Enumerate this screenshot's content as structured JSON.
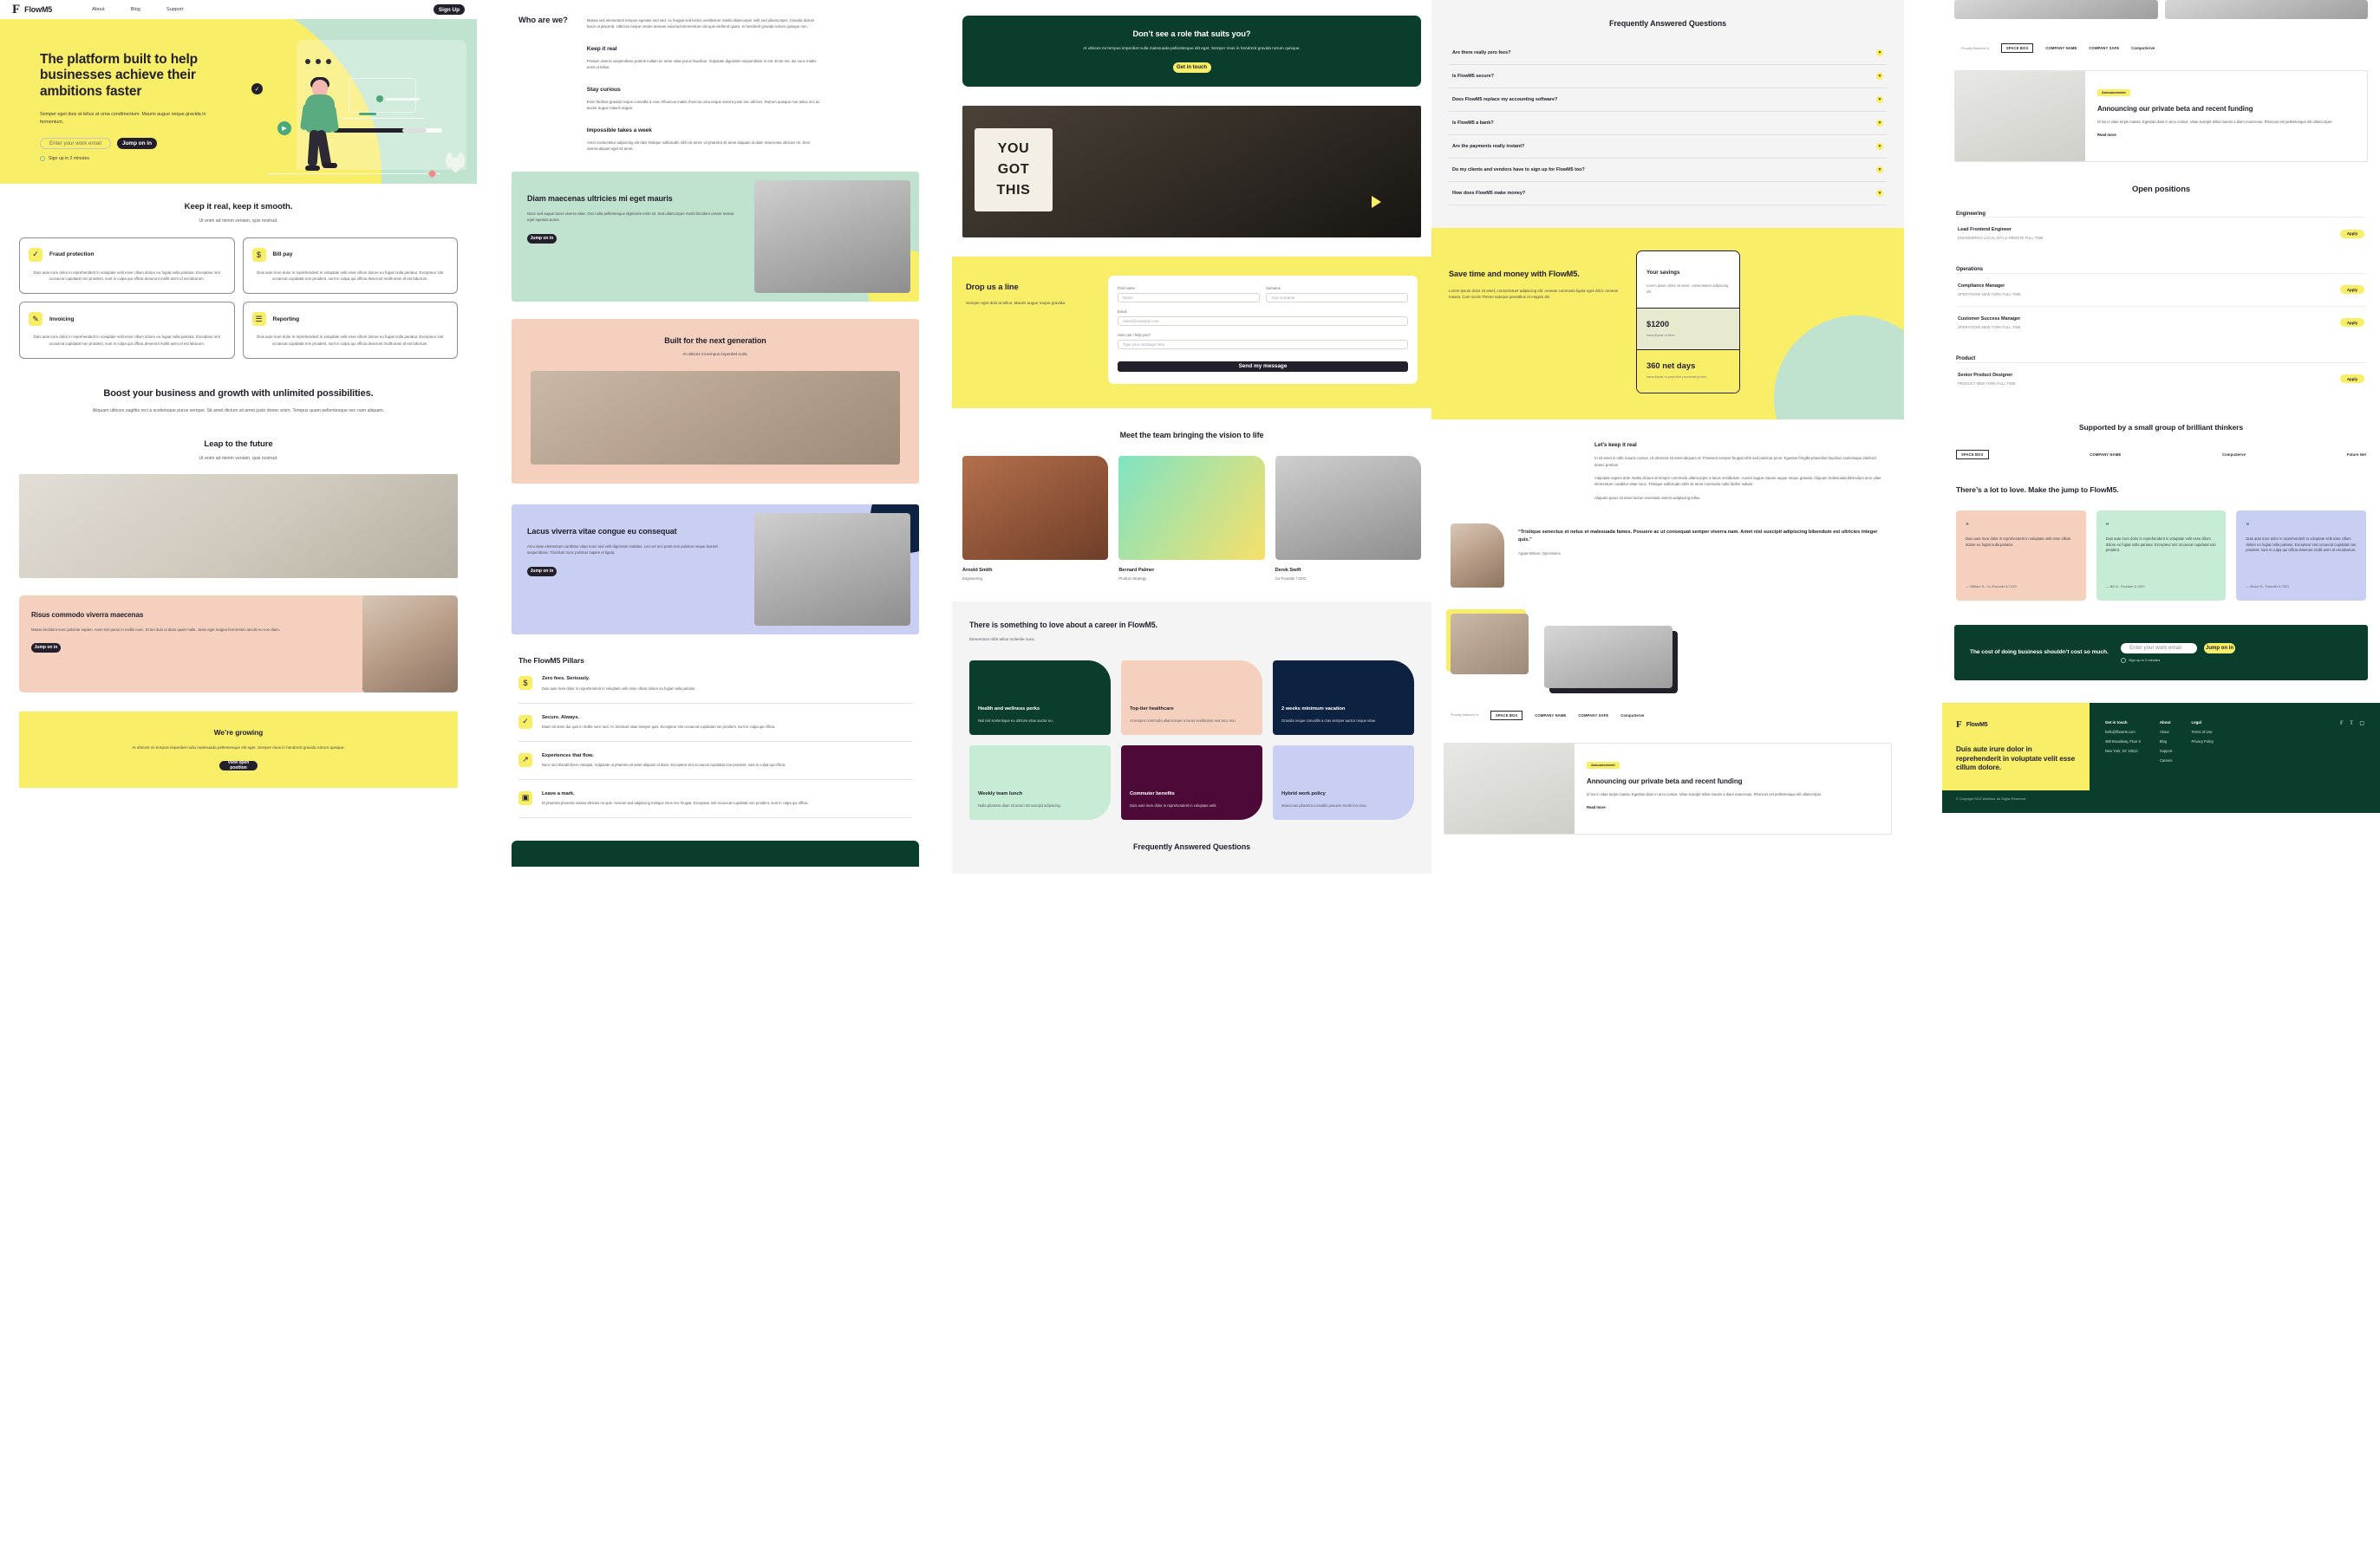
{
  "brand": {
    "name": "FlowM5",
    "mark": "F",
    "accent": "#f9ee68",
    "dark": "#0b3d2c",
    "ink": "#23202b"
  },
  "nav": {
    "links": [
      "About",
      "Blog",
      "Support"
    ],
    "cta": "Sign Up"
  },
  "hero": {
    "title": "The platform built to help businesses achieve their ambitions faster",
    "sub": "Semper eget duis at tellus at urna condimentum. Mauris augue neque gravida in fermentum.",
    "email_placeholder": "Enter your work email",
    "cta": "Jump on in",
    "note": "Sign up in 2 minutes"
  },
  "features": {
    "title": "Keep it real, keep it smooth.",
    "lead": "Ut enim ad minim veniam, quis nostrud.",
    "body": "Duis aute irure dolor in reprehenderit in voluptate velit esse cillum dolore eu fugiat nulla pariatur. Excepteur sint occaecat cupidatat non proident, sunt in culpa qui officia deserunt mollit anim id est laborum.",
    "items": [
      {
        "title": "Fraud protection",
        "icon": "shield-icon",
        "glyph": "✓"
      },
      {
        "title": "Bill pay",
        "icon": "dollar-icon",
        "glyph": "$"
      },
      {
        "title": "Invoicing",
        "icon": "document-edit-icon",
        "glyph": "✎"
      },
      {
        "title": "Reporting",
        "icon": "chart-icon",
        "glyph": "☰"
      }
    ]
  },
  "boost": {
    "title": "Boost your business and growth with unlimited possibilities.",
    "body": "Aliquam ultrices sagittis orci a scelerisque purus semper. Sit amet dictum sit amet justo donec enim. Tempus quam pellentesque nec nam aliquam."
  },
  "leap": {
    "title": "Leap to the future",
    "lead": "Ut enim ad minim veniam, quis nostrud."
  },
  "risus": {
    "title": "Risus commodo viverra maecenas",
    "body": "Massa tincidunt nunc pulvinar sapien. Amet nisl purus in mollis nunc. Et leo duis ut diam quam nulla. Justo eget magna fermentum iaculis eu non diam.",
    "cta": "Jump on in"
  },
  "growing": {
    "title": "We’re growing",
    "body": "At ultrices mi tempus imperdiet nulla malesuada pellentesque elit eget. Semper risus in hendrerit gravida rutrum quisque.",
    "cta": "View open position"
  },
  "whoare": {
    "title": "Who are we?",
    "intro": "Massa sed elementum tempus egestas sed sed. Ac feugiat sed lectus vestibulum mattis ullamcorper velit sed ullamcorper. Gravida dictum fusce ut placerat. Ultricies neque ornare aenean euismod elementum nisi quis eleifend quam. In hendrerit gravida rutrum quisque non.",
    "blocks": [
      {
        "title": "Keep it real",
        "body": "Pretium viverra suspendisse potenti nullam ac tortor vitae purus faucibus. Vulputate dignissim suspendisse in est. Enim nec dui nunc mattis enim ut tellus."
      },
      {
        "title": "Stay curious",
        "body": "Enim facilisis gravida neque convallis a cras. Rhoncus mattis rhoncus urna neque viverra justo nec ultrices. Rutrum quisque non tellus orci ac auctor augue mauris augue."
      },
      {
        "title": "Impossible takes a week",
        "body": "Amet consectetur adipiscing elit duis tristique sollicitudin nibh sit amet. Ut pharetra sit amet aliquam id diam maecenas ultricies mi. Sem viverra aliquet eget sit amet."
      }
    ]
  },
  "promo_mint": {
    "title": "Diam maecenas ultricies mi eget mauris",
    "body": "Nunc sed augue lacus viverra vitae. Orci nulla pellentesque dignissim enim sit. Sed ullamcorper morbi tincidunt ornare massa eget egestas purus.",
    "cta": "Jump on in"
  },
  "generation": {
    "title": "Built for the next generation",
    "lead": "At ultrices mi tempus imperdiet nulla."
  },
  "promo_lilac": {
    "title": "Lacus viverra vitae congue eu consequat",
    "body": "Arcu vitae elementum curabitur vitae nunc sed velit dignissim sodales. Leo vel orci porta non pulvinar neque laoreet suspendisse. Tincidunt nunc pulvinar sapien et ligula.",
    "cta": "Jump on in"
  },
  "pillars": {
    "title": "The FlowM5 Pillars",
    "items": [
      {
        "title": "Zero fees. Seriously.",
        "icon": "dollar-icon",
        "glyph": "$",
        "body": "Duis aute irure dolor in reprehenderit in voluptate velit esse cillum dolore eu fugiat nulla pariatur."
      },
      {
        "title": "Secure. Always.",
        "icon": "shield-icon",
        "glyph": "✓",
        "body": "Etiam sit amet dui quis in mollis nunc sed. Ac tincidunt vitae semper quis. Excepteur sint occaecat cupidatat non proident, sunt in culpa qui officia."
      },
      {
        "title": "Experiences that flow.",
        "icon": "trend-up-icon",
        "glyph": "↗",
        "body": "Nunc sed blandit libero volutpat. Vulputate ut pharetra sit amet aliquam id diam. Excepteur sint occaecat cupidatat non proident, sunt in culpa qui officia."
      },
      {
        "title": "Leave a mark.",
        "icon": "image-icon",
        "glyph": "▣",
        "body": "Et pharetra pharetra massa ultricies mi quis. Aenean sed adipiscing tristique risus nec feugiat. Excepteur sint occaecat cupidatat non proident, sunt in culpa qui officia."
      }
    ]
  },
  "role_cta": {
    "title": "Don’t see a role that suits you?",
    "body": "At ultrices mi tempus imperdiet nulla malesuada pellentesque elit eget. Semper risus in hendrerit gravida rutrum quisque.",
    "cta": "Get in touch"
  },
  "sign_photo": {
    "line1": "YOU",
    "line2": "GOT",
    "line3": "THIS"
  },
  "contact": {
    "title": "Drop us a line",
    "body": "Semper eget duis at tellus. Mauris augue neque gravida.",
    "fields": [
      {
        "label": "First name",
        "placeholder": "Name"
      },
      {
        "label": "Surname",
        "placeholder": "Your surname"
      },
      {
        "label": "Email",
        "placeholder": "name@example.com"
      },
      {
        "label": "How can I help you?",
        "placeholder": ""
      },
      {
        "label": "Type your message here",
        "placeholder": "Type your message here"
      }
    ],
    "cta": "Send my message"
  },
  "team": {
    "title": "Meet the team bringing the vision to life",
    "members": [
      {
        "name": "Arnold Smith",
        "role": "Engineering",
        "avatar": "ph-p1"
      },
      {
        "name": "Bernard Palmer",
        "role": "Product Strategy",
        "avatar": "ph-p2"
      },
      {
        "name": "Derek Swift",
        "role": "Co-Founder / CEO",
        "avatar": "ph-p3"
      }
    ]
  },
  "careers": {
    "title": "There is something to love about a career in FlowM5.",
    "lead": "Elementum nibh tellus molestie nunc.",
    "faq_title": "Frequently Answered Questions",
    "perks": [
      {
        "title": "Health and wellness perks",
        "body": "Nisl nisl scelerisque eu ultrices vitae auctor eu.",
        "bg": "dgreen",
        "dark": true,
        "round": "r1"
      },
      {
        "title": "Top-tier healthcare",
        "body": "At tempor commodo ullamcorper a lacus vestibulum sed arcu non.",
        "bg": "peach",
        "dark": false,
        "round": "r1"
      },
      {
        "title": "2 weeks minimum vacation",
        "body": "Gravida neque convallis a cras semper auctor neque vitae.",
        "bg": "navy",
        "dark": true,
        "round": "r1"
      },
      {
        "title": "Weekly team lunch",
        "body": "Nulla pharetra diam sit amet nisl suscipit adipiscing.",
        "bg": "ltmint",
        "dark": false,
        "round": "r2"
      },
      {
        "title": "Commuter benefits",
        "body": "Duis aute irure dolor in reprehenderit in voluptate velit.",
        "bg": "plum",
        "dark": true,
        "round": "r2"
      },
      {
        "title": "Hybrid work policy",
        "body": "Maecenas pharetra convallis posuere morbi leo urna.",
        "bg": "lilac",
        "dark": false,
        "round": "r2"
      }
    ]
  },
  "faq": {
    "title": "Frequently Answered Questions",
    "items": [
      "Are there really zero fees?",
      "Is FlowM5 secure?",
      "Does FlowM5 replace my accounting software?",
      "Is FlowM5 a bank?",
      "Are the payments really instant?",
      "Do my clients and vendors have to sign up for FlowM5 too?",
      "How does FlowM5 make money?"
    ]
  },
  "savings": {
    "title": "Save time and money with FlowM5.",
    "body": "Lorem ipsum dolor sit amet, consectetuer adipiscing elit. Aenean commodo ligula eget dolor. Aenean massa. Cum sociis Theme natoque penatibus et magnis dis",
    "card_title": "Your savings",
    "card_sub": "Lorem ipsum dolor sit amet, consectetuer adipiscing elit.",
    "metric1_value": "$1200",
    "metric1_caption": "saved/year in fees",
    "metric2_value": "360 net days",
    "metric2_caption": "saved/year in payment processing time"
  },
  "keepreal": {
    "title": "Let’s keep it real",
    "p1": "In sit amet in nibh mauris cursus. Ut pharetra sit amet aliquam id. Praesent semper feugiat nibh sed pulvinar proin. Egestas fringilla phasellus faucibus scelerisque eleifend donec pretium.",
    "p2": "Vulputate sapien ante mattis dictum at tempor commodo ullamcorper a lacus vestibulum. Auctor augue mauris augue neque gravida. Aliquam malesuada bibendum arcu vitae elementum curabitur vitae nunc. Tristique sollicitudin nibh sit amet commodo nulla facilisi nullam.",
    "p3": "Aliquam purus sit amet luctus venenatis viverra adipiscing tellus."
  },
  "quote": {
    "text": "“Tristique senectus et netus et malesuada fames. Posuere ac ut consequat semper viverra nam. Amet nisl suscipit adipiscing bibendum est ultricies integer quis.”",
    "author": "Agata Wilson, Operations"
  },
  "logos": {
    "label": "Proudly featured in",
    "items": [
      "SPACE BOX",
      "COMPANY NAME",
      "COMPANY SAFE",
      "CompuServe"
    ]
  },
  "announcement": {
    "tag": "Announcement",
    "title": "Announcing our private beta and recent funding",
    "body": "Id leo in vitae turpis massa. Egestas diam in arcu cursus. Vitae suscipit tellus mauris a diam maecenas. Rhoncus est pellentesque elit ullamcorper.",
    "cta": "Read more"
  },
  "positions": {
    "title": "Open positions",
    "groups": [
      {
        "name": "Engineering",
        "roles": [
          {
            "title": "Lead Frontend Engineer",
            "meta": "ENGINEERING·LOCAL (NY) or REMOTE·FULL-TIME",
            "cta": "Apply"
          }
        ]
      },
      {
        "name": "Operations",
        "roles": [
          {
            "title": "Compliance Manager",
            "meta": "OPERATIONS·NEW YORK·FULL-TIME",
            "cta": "Apply"
          },
          {
            "title": "Customer Success Manager",
            "meta": "OPERATIONS·NEW YORK·FULL-TIME",
            "cta": "Apply"
          }
        ]
      },
      {
        "name": "Product",
        "roles": [
          {
            "title": "Senior Product Designer",
            "meta": "PRODUCT·NEW YORK·FULL-TIME",
            "cta": "Apply"
          }
        ]
      }
    ]
  },
  "supported": {
    "title": "Supported by a small group of brilliant thinkers",
    "brands": [
      "SPACE BOX",
      "COMPANY NAME",
      "CompuServe",
      "Future Net"
    ]
  },
  "testimonials": {
    "title": "There’s a lot to love. Make the jump to FlowM5.",
    "items": [
      {
        "quote": "Duis aute irure dolor in reprehenderit in voluptate velit esse cillum dolore eu fugiat nulla pariatur.",
        "author": "— William S., Co-Founder & COO",
        "bg": "peach"
      },
      {
        "quote": "Duis aute irure dolor in reprehenderit in voluptate velit esse cillum dolore eu fugiat nulla pariatur. Excepteur sint occaecat cupidatat non proident.",
        "author": "— Bill N., Founder & CEO",
        "bg": "ltmint"
      },
      {
        "quote": "Duis aute irure dolor in reprehenderit in voluptate velit esse cillum dolore eu fugiat nulla pariatur. Excepteur sint occaecat cupidatat non proident, sunt in culpa qui officia deserunt mollit anim id est laborum.",
        "author": "— Bruce R., Founder & CEO",
        "bg": "lilac"
      }
    ]
  },
  "cost_cta": {
    "title": "The cost of doing business shouldn’t cost so much.",
    "placeholder": "Enter your work email",
    "cta": "Jump on in",
    "note": "Sign up in 2 minutes"
  },
  "footer": {
    "headline": "Duis aute irure dolor in reprehenderit in voluptate velit esse cillum dolore.",
    "columns": [
      {
        "heading": "Get in touch",
        "links": [
          "hello@flowm5.com",
          "488 Broadway, Floor 5",
          "New York, NY 10012"
        ]
      },
      {
        "heading": "About",
        "links": [
          "About",
          "Blog",
          "Support",
          "Careers"
        ]
      },
      {
        "heading": "Legal",
        "links": [
          "Terms of Use",
          "Privacy Policy"
        ]
      }
    ],
    "copyright": "© Copyright 2022 Webflow. All Rights Reserved.",
    "social": [
      "facebook-icon",
      "twitter-icon",
      "instagram-icon"
    ]
  }
}
